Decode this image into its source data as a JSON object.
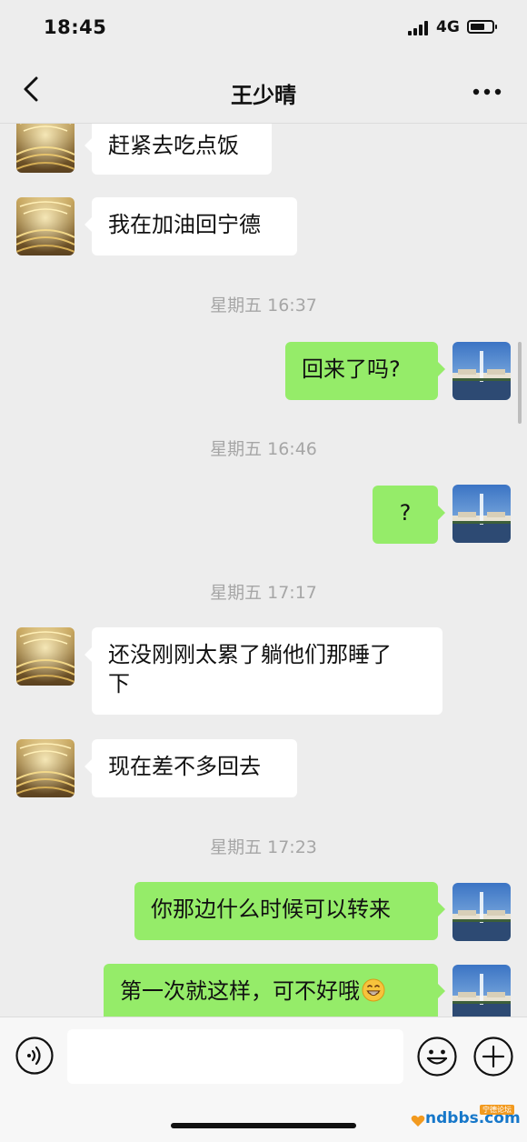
{
  "status_bar": {
    "time": "18:45",
    "network": "4G"
  },
  "header": {
    "title": "王少晴"
  },
  "messages": {
    "m1": "赶紧去吃点饭",
    "m2": "我在加油回宁德",
    "t1": "星期五 16:37",
    "m3": "回来了吗?",
    "t2": "星期五 16:46",
    "m4": "?",
    "t3": "星期五 17:17",
    "m5_line1": "还没刚刚太累了躺他们那睡了",
    "m5_line2": "下",
    "m6": "现在差不多回去",
    "t4": "星期五 17:23",
    "m7": "你那边什么时候可以转来",
    "m8": "第一次就这样，可不好哦",
    "m8_emoji": "grinning-emoji"
  },
  "input_bar": {
    "value": "",
    "placeholder": ""
  },
  "icons": {
    "back": "chevron-left-icon",
    "more": "more-dots-icon",
    "voice": "voice-icon",
    "emoji": "smiley-icon",
    "plus": "plus-icon"
  },
  "watermark": {
    "text": "ndbbs.com",
    "badge": "宁德论坛"
  },
  "colors": {
    "background": "#ededed",
    "bubble_self": "#95ec69",
    "bubble_other": "#ffffff",
    "timestamp": "#a6a6a6"
  }
}
